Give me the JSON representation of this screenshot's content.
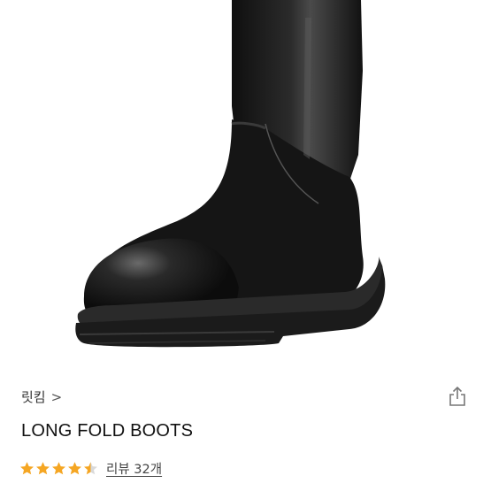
{
  "product": {
    "image_alt": "long fold boots product image",
    "brand": "릿킴",
    "brand_chevron": ">",
    "title": "LONG FOLD BOOTS",
    "rating": 4.5,
    "reviews_label": "리뷰 32개"
  },
  "icons": {
    "share": "share-icon",
    "star": "star-icon",
    "chevron": "chevron-right-icon"
  },
  "colors": {
    "star": "#F5A623",
    "text": "#111111"
  }
}
